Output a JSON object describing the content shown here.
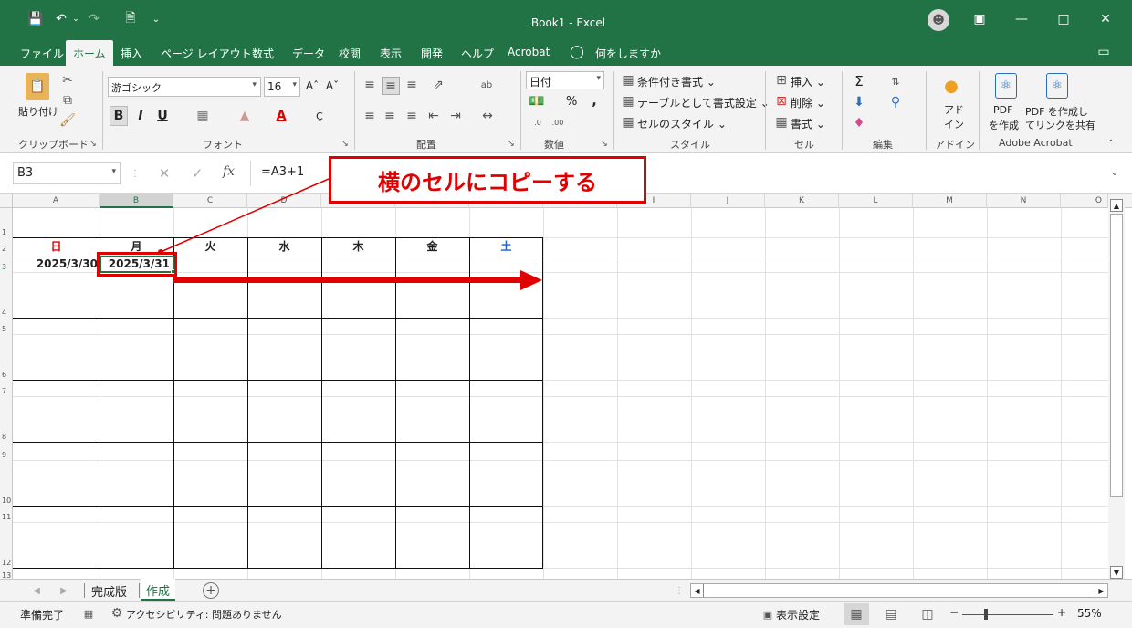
{
  "title": {
    "app_title": "Book1  -  Excel"
  },
  "tabs": [
    {
      "label": "ファイル"
    },
    {
      "label": "ホーム"
    },
    {
      "label": "挿入"
    },
    {
      "label": "ページ レイアウト"
    },
    {
      "label": "数式"
    },
    {
      "label": "データ"
    },
    {
      "label": "校閲"
    },
    {
      "label": "表示"
    },
    {
      "label": "開発"
    },
    {
      "label": "ヘルプ"
    },
    {
      "label": "Acrobat"
    },
    {
      "label": "何をしますか"
    }
  ],
  "ribbon": {
    "clipboard": {
      "paste": "貼り付け",
      "label": "クリップボード"
    },
    "font": {
      "name": "游ゴシック",
      "size": "16",
      "label": "フォント"
    },
    "alignment": {
      "label": "配置"
    },
    "number": {
      "format": "日付",
      "label": "数値",
      "percent": "%"
    },
    "styles": {
      "conditional": "条件付き書式 ⌄",
      "table": "テーブルとして書式設定 ⌄",
      "cell_styles": "セルのスタイル ⌄",
      "label": "スタイル"
    },
    "cells": {
      "insert": "挿入 ⌄",
      "delete": "削除 ⌄",
      "format": "書式 ⌄",
      "label": "セル"
    },
    "editing": {
      "label": "編集"
    },
    "addins": {
      "line1": "アド",
      "line2": "イン",
      "label": "アドイン"
    },
    "acrobat": {
      "pdf1_line1": "PDF",
      "pdf1_line2": "を作成",
      "pdf2_line1": "PDF を作成し",
      "pdf2_line2": "てリンクを共有",
      "label": "Adobe Acrobat"
    }
  },
  "formula_bar": {
    "name_box": "B3",
    "formula": "=A3+1",
    "fx": "fx"
  },
  "callout": {
    "text": "横のセルにコピーする"
  },
  "columns": [
    "A",
    "B",
    "C",
    "D",
    "E",
    "F",
    "G",
    "H",
    "I",
    "J",
    "K",
    "L",
    "M",
    "N",
    "O"
  ],
  "rows": [
    "1",
    "2",
    "3",
    "4",
    "5",
    "6",
    "7",
    "8",
    "9",
    "10",
    "11",
    "12",
    "13"
  ],
  "weekdays": [
    {
      "label": "日",
      "color": "#e00000"
    },
    {
      "label": "月",
      "color": "#222222"
    },
    {
      "label": "火",
      "color": "#222222"
    },
    {
      "label": "水",
      "color": "#222222"
    },
    {
      "label": "木",
      "color": "#222222"
    },
    {
      "label": "金",
      "color": "#222222"
    },
    {
      "label": "土",
      "color": "#1a5fd6"
    }
  ],
  "cells": {
    "a3": "2025/3/30",
    "b3": "2025/3/31"
  },
  "sheets": [
    {
      "label": "完成版"
    },
    {
      "label": "作成"
    }
  ],
  "status": {
    "ready": "準備完了",
    "accessibility": "アクセシビリティ: 問題ありません",
    "display_settings": "表示設定",
    "zoom": "55%",
    "zoom_minus": "−",
    "zoom_plus": "+"
  },
  "colors": {
    "excel_green": "#217346",
    "annotation_red": "#e00000"
  }
}
